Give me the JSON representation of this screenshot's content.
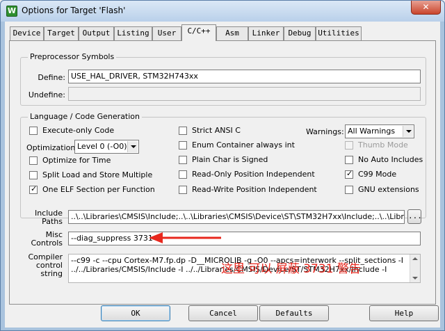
{
  "window": {
    "title": "Options for Target 'Flash'",
    "icon_letter": "W",
    "close_glyph": "✕"
  },
  "tabs": [
    "Device",
    "Target",
    "Output",
    "Listing",
    "User",
    "C/C++",
    "Asm",
    "Linker",
    "Debug",
    "Utilities"
  ],
  "active_tab": "C/C++",
  "preprocessor": {
    "title": "Preprocessor Symbols",
    "define_label": "Define:",
    "define_value": "USE_HAL_DRIVER, STM32H743xx",
    "undefine_label": "Undefine:",
    "undefine_value": ""
  },
  "language": {
    "title": "Language / Code Generation",
    "execute_only": {
      "label": "Execute-only Code",
      "checked": false
    },
    "optimization_label": "Optimization:",
    "optimization_value": "Level 0 (-O0)",
    "optimize_time": {
      "label": "Optimize for Time",
      "checked": false
    },
    "split_load": {
      "label": "Split Load and Store Multiple",
      "checked": false
    },
    "one_elf": {
      "label": "One ELF Section per Function",
      "checked": true
    },
    "strict_ansi": {
      "label": "Strict ANSI C",
      "checked": false
    },
    "enum_container": {
      "label": "Enum Container always int",
      "checked": false
    },
    "plain_char": {
      "label": "Plain Char is Signed",
      "checked": false
    },
    "read_only_pi": {
      "label": "Read-Only Position Independent",
      "checked": false
    },
    "read_write_pi": {
      "label": "Read-Write Position Independent",
      "checked": false
    },
    "warnings_label": "Warnings:",
    "warnings_value": "All Warnings",
    "thumb_mode": {
      "label": "Thumb Mode",
      "checked": false,
      "disabled": true
    },
    "no_auto_includes": {
      "label": "No Auto Includes",
      "checked": false
    },
    "c99_mode": {
      "label": "C99 Mode",
      "checked": true
    },
    "gnu_extensions": {
      "label": "GNU extensions",
      "checked": false
    }
  },
  "include_paths": {
    "label_line1": "Include",
    "label_line2": "Paths",
    "value": "..\\..\\Libraries\\CMSIS\\Include;..\\..\\Libraries\\CMSIS\\Device\\ST\\STM32H7xx\\Include;..\\..\\Libraries\\S",
    "browse_label": "..."
  },
  "misc_controls": {
    "label_line1": "Misc",
    "label_line2": "Controls",
    "value": "--diag_suppress 3731"
  },
  "compiler_control": {
    "label_line1": "Compiler",
    "label_line2": "control",
    "label_line3": "string",
    "line1": "--c99 -c --cpu Cortex-M7.fp.dp -D__MICROLIB -g -O0 --apcs=interwork --split_sections -I",
    "line2": "../../Libraries/CMSIS/Include -I ../../Libraries/CMSIS/Device/ST/STM32H7xx/Include -I"
  },
  "annotation": {
    "text": "这里 可以 屏蔽 3731 警告",
    "color": "#e8281e"
  },
  "buttons": {
    "ok": "OK",
    "cancel": "Cancel",
    "defaults": "Defaults",
    "help": "Help"
  }
}
